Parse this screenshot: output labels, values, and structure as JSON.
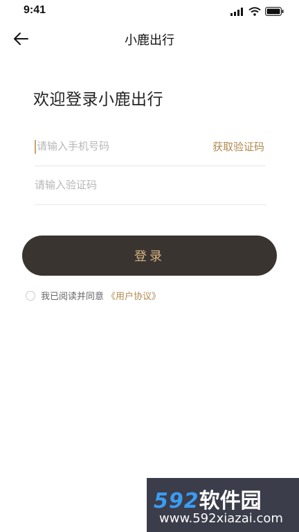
{
  "status_bar": {
    "time": "9:41"
  },
  "nav": {
    "title": "小鹿出行"
  },
  "welcome_text": "欢迎登录小鹿出行",
  "phone_field": {
    "placeholder": "请输入手机号码",
    "value": ""
  },
  "get_code_label": "获取验证码",
  "code_field": {
    "placeholder": "请输入验证码",
    "value": ""
  },
  "login_label": "登录",
  "agreement": {
    "checked": false,
    "prefix": "我已阅读并同意",
    "link": "《用户协议》"
  },
  "watermark": {
    "logo_number": "592",
    "logo_text": "软件园",
    "url": "www.592xiazai.com"
  },
  "colors": {
    "accent": "#b08a4f",
    "button_bg": "#3a3431",
    "button_text": "#d6b483"
  },
  "icons": [
    "signal-icon",
    "wifi-icon",
    "battery-icon",
    "back-arrow-icon"
  ]
}
